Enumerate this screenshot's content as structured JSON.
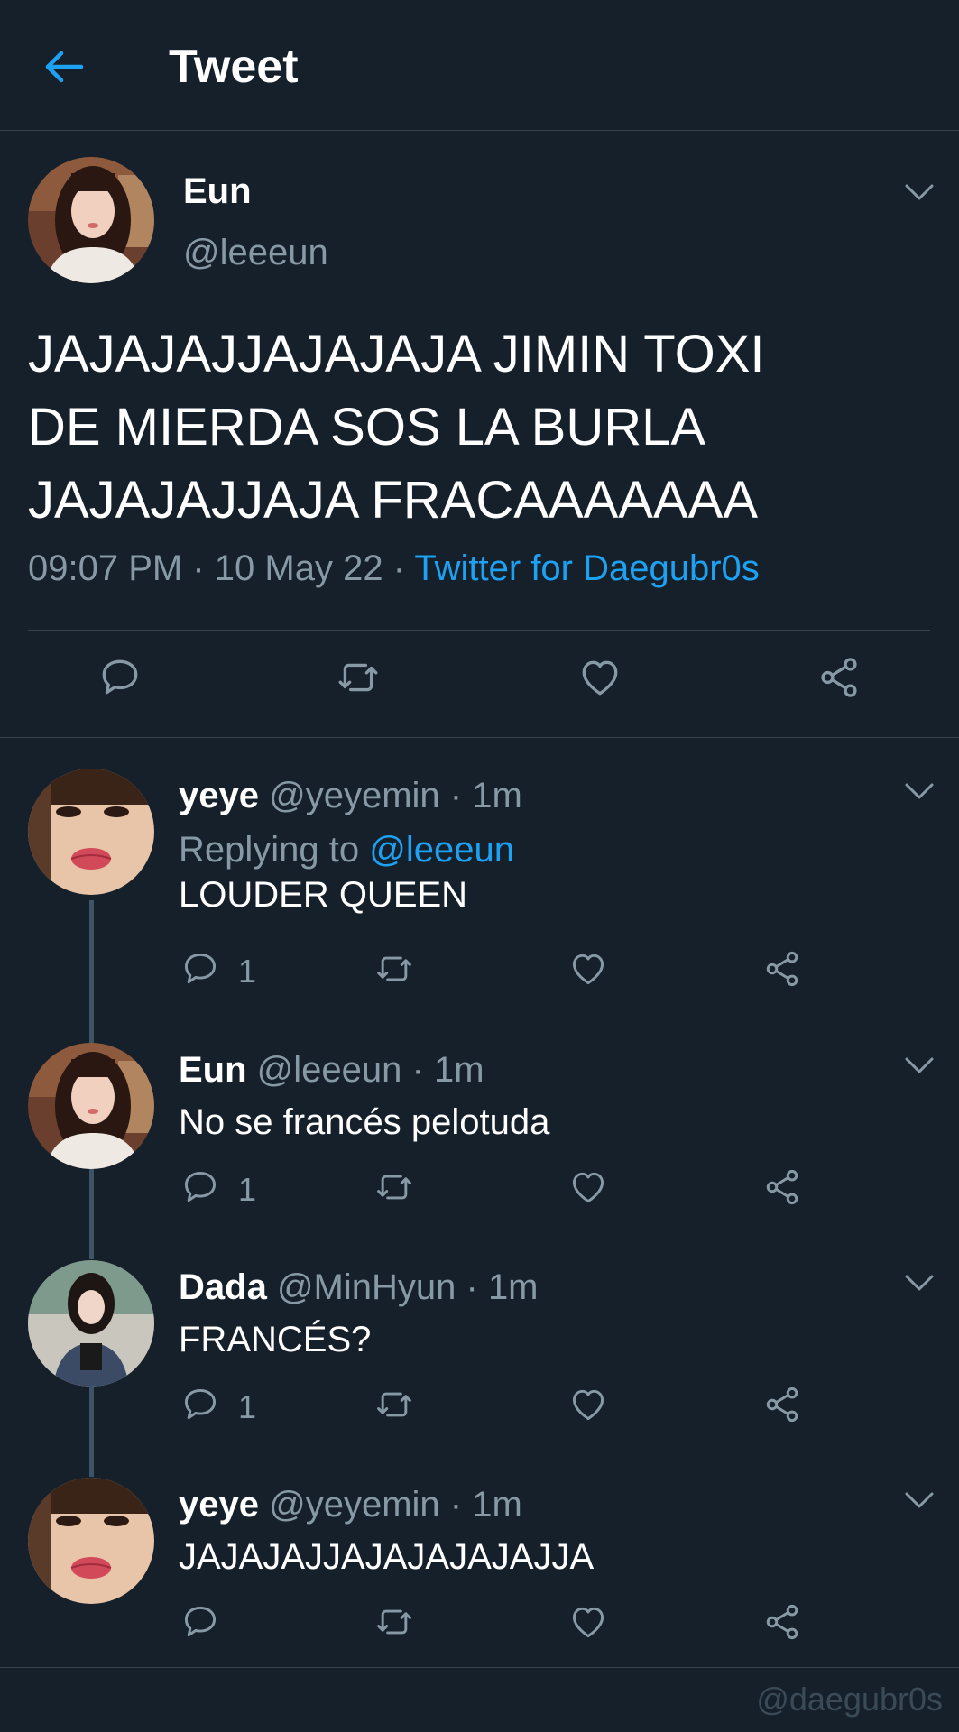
{
  "header": {
    "title": "Tweet"
  },
  "tweet": {
    "name": "Eun",
    "handle": "@leeeun",
    "text": "JAJAJAJJAJAJAJA JIMIN TOXI\nDE MIERDA SOS LA BURLA\nJAJAJAJJAJA FRACAAAAAAA",
    "time": "09:07 PM",
    "date": "10 May 22",
    "source": "Twitter for Daegubr0s"
  },
  "replies": [
    {
      "name": "yeye",
      "handle": "@yeyemin",
      "time": "1m",
      "replying_label": "Replying to",
      "replying_to": "@leeeun",
      "text": "LOUDER QUEEN",
      "reply_count": "1"
    },
    {
      "name": "Eun",
      "handle": "@leeeun",
      "time": "1m",
      "text": "No se francés pelotuda",
      "reply_count": "1"
    },
    {
      "name": "Dada",
      "handle": "@MinHyun",
      "time": "1m",
      "text": "FRANCÉS?",
      "reply_count": "1"
    },
    {
      "name": "yeye",
      "handle": "@yeyemin",
      "time": "1m",
      "text": "JAJAJAJJAJAJAJAJAJJA",
      "reply_count": ""
    }
  ],
  "watermark": "@daegubr0s",
  "colors": {
    "background": "#15202b",
    "accent": "#1da1f2",
    "muted": "#8899a6",
    "divider": "#38444d"
  },
  "icons": [
    "back-arrow-icon",
    "chevron-down-icon",
    "reply-icon",
    "retweet-icon",
    "like-icon",
    "share-icon"
  ]
}
